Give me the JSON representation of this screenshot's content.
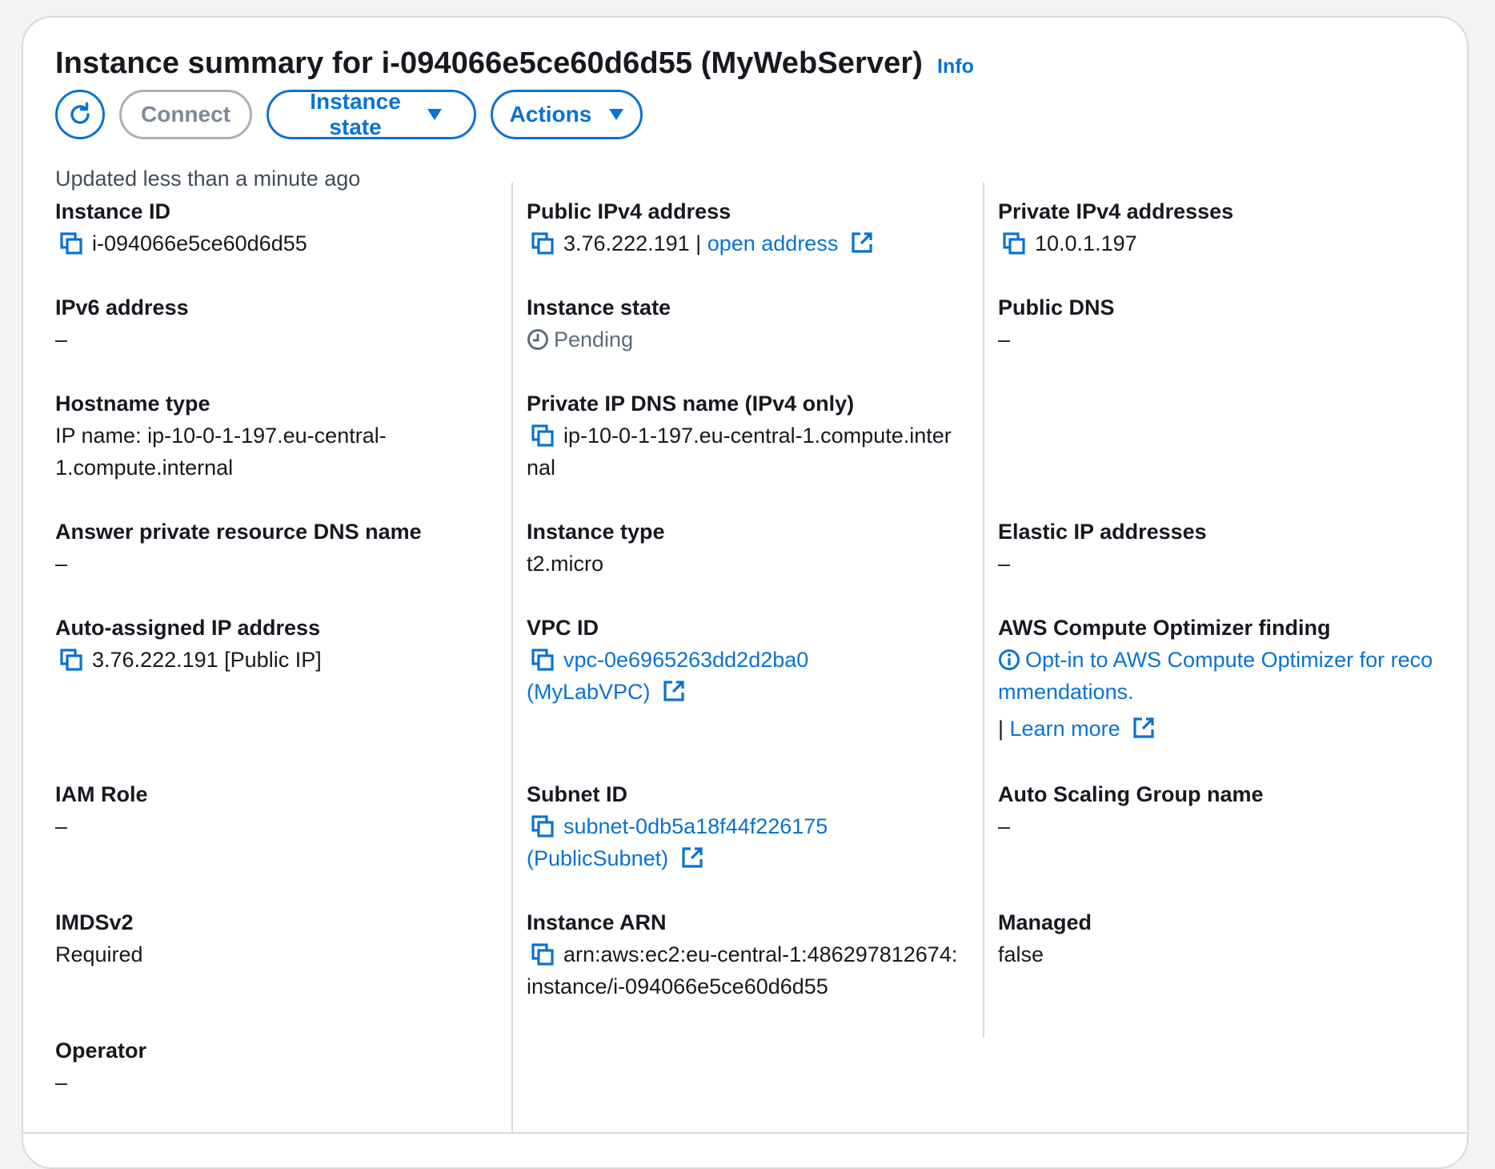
{
  "header": {
    "title": "Instance summary for i-094066e5ce60d6d55 (MyWebServer)",
    "info_label": "Info"
  },
  "toolbar": {
    "connect_label": "Connect",
    "instance_state_label": "Instance state",
    "actions_label": "Actions"
  },
  "updated_text": "Updated less than a minute ago",
  "fields": {
    "instance_id": {
      "label": "Instance ID",
      "value": "i-094066e5ce60d6d55"
    },
    "ipv6": {
      "label": "IPv6 address",
      "value": "–"
    },
    "hostname_type": {
      "label": "Hostname type",
      "value": "IP name: ip-10-0-1-197.eu-central-1.compute.internal"
    },
    "answer_dns": {
      "label": "Answer private resource DNS name",
      "value": "–"
    },
    "auto_ip": {
      "label": "Auto-assigned IP address",
      "value": "3.76.222.191 [Public IP]"
    },
    "iam_role": {
      "label": "IAM Role",
      "value": "–"
    },
    "imdsv2": {
      "label": "IMDSv2",
      "value": "Required"
    },
    "operator": {
      "label": "Operator",
      "value": "–"
    },
    "public_ipv4": {
      "label": "Public IPv4 address",
      "value": "3.76.222.191",
      "separator": "|",
      "link": "open address"
    },
    "instance_state": {
      "label": "Instance state",
      "value": "Pending"
    },
    "private_dns": {
      "label": "Private IP DNS name (IPv4 only)",
      "value": "ip-10-0-1-197.eu-central-1.compute.internal"
    },
    "instance_type": {
      "label": "Instance type",
      "value": "t2.micro"
    },
    "vpc_id": {
      "label": "VPC ID",
      "value": "vpc-0e6965263dd2d2ba0 (MyLabVPC)"
    },
    "subnet_id": {
      "label": "Subnet ID",
      "value": "subnet-0db5a18f44f226175 (PublicSubnet)"
    },
    "instance_arn": {
      "label": "Instance ARN",
      "value": "arn:aws:ec2:eu-central-1:486297812674:instance/i-094066e5ce60d6d55"
    },
    "private_ipv4": {
      "label": "Private IPv4 addresses",
      "value": "10.0.1.197"
    },
    "public_dns": {
      "label": "Public DNS",
      "value": "–"
    },
    "elastic_ip": {
      "label": "Elastic IP addresses",
      "value": "–"
    },
    "optimizer": {
      "label": "AWS Compute Optimizer finding",
      "link": "Opt-in to AWS Compute Optimizer for recommendations.",
      "separator": "|",
      "learn_more": "Learn more"
    },
    "asg_name": {
      "label": "Auto Scaling Group name",
      "value": "–"
    },
    "managed": {
      "label": "Managed",
      "value": "false"
    }
  },
  "colors": {
    "link": "#0972d3",
    "text": "#16191f",
    "muted": "#5f6b7a",
    "divider": "#d5dbdb"
  },
  "icons": [
    "refresh-icon",
    "caret-down-icon",
    "copy-icon",
    "external-link-icon",
    "clock-icon",
    "info-circle-icon"
  ]
}
